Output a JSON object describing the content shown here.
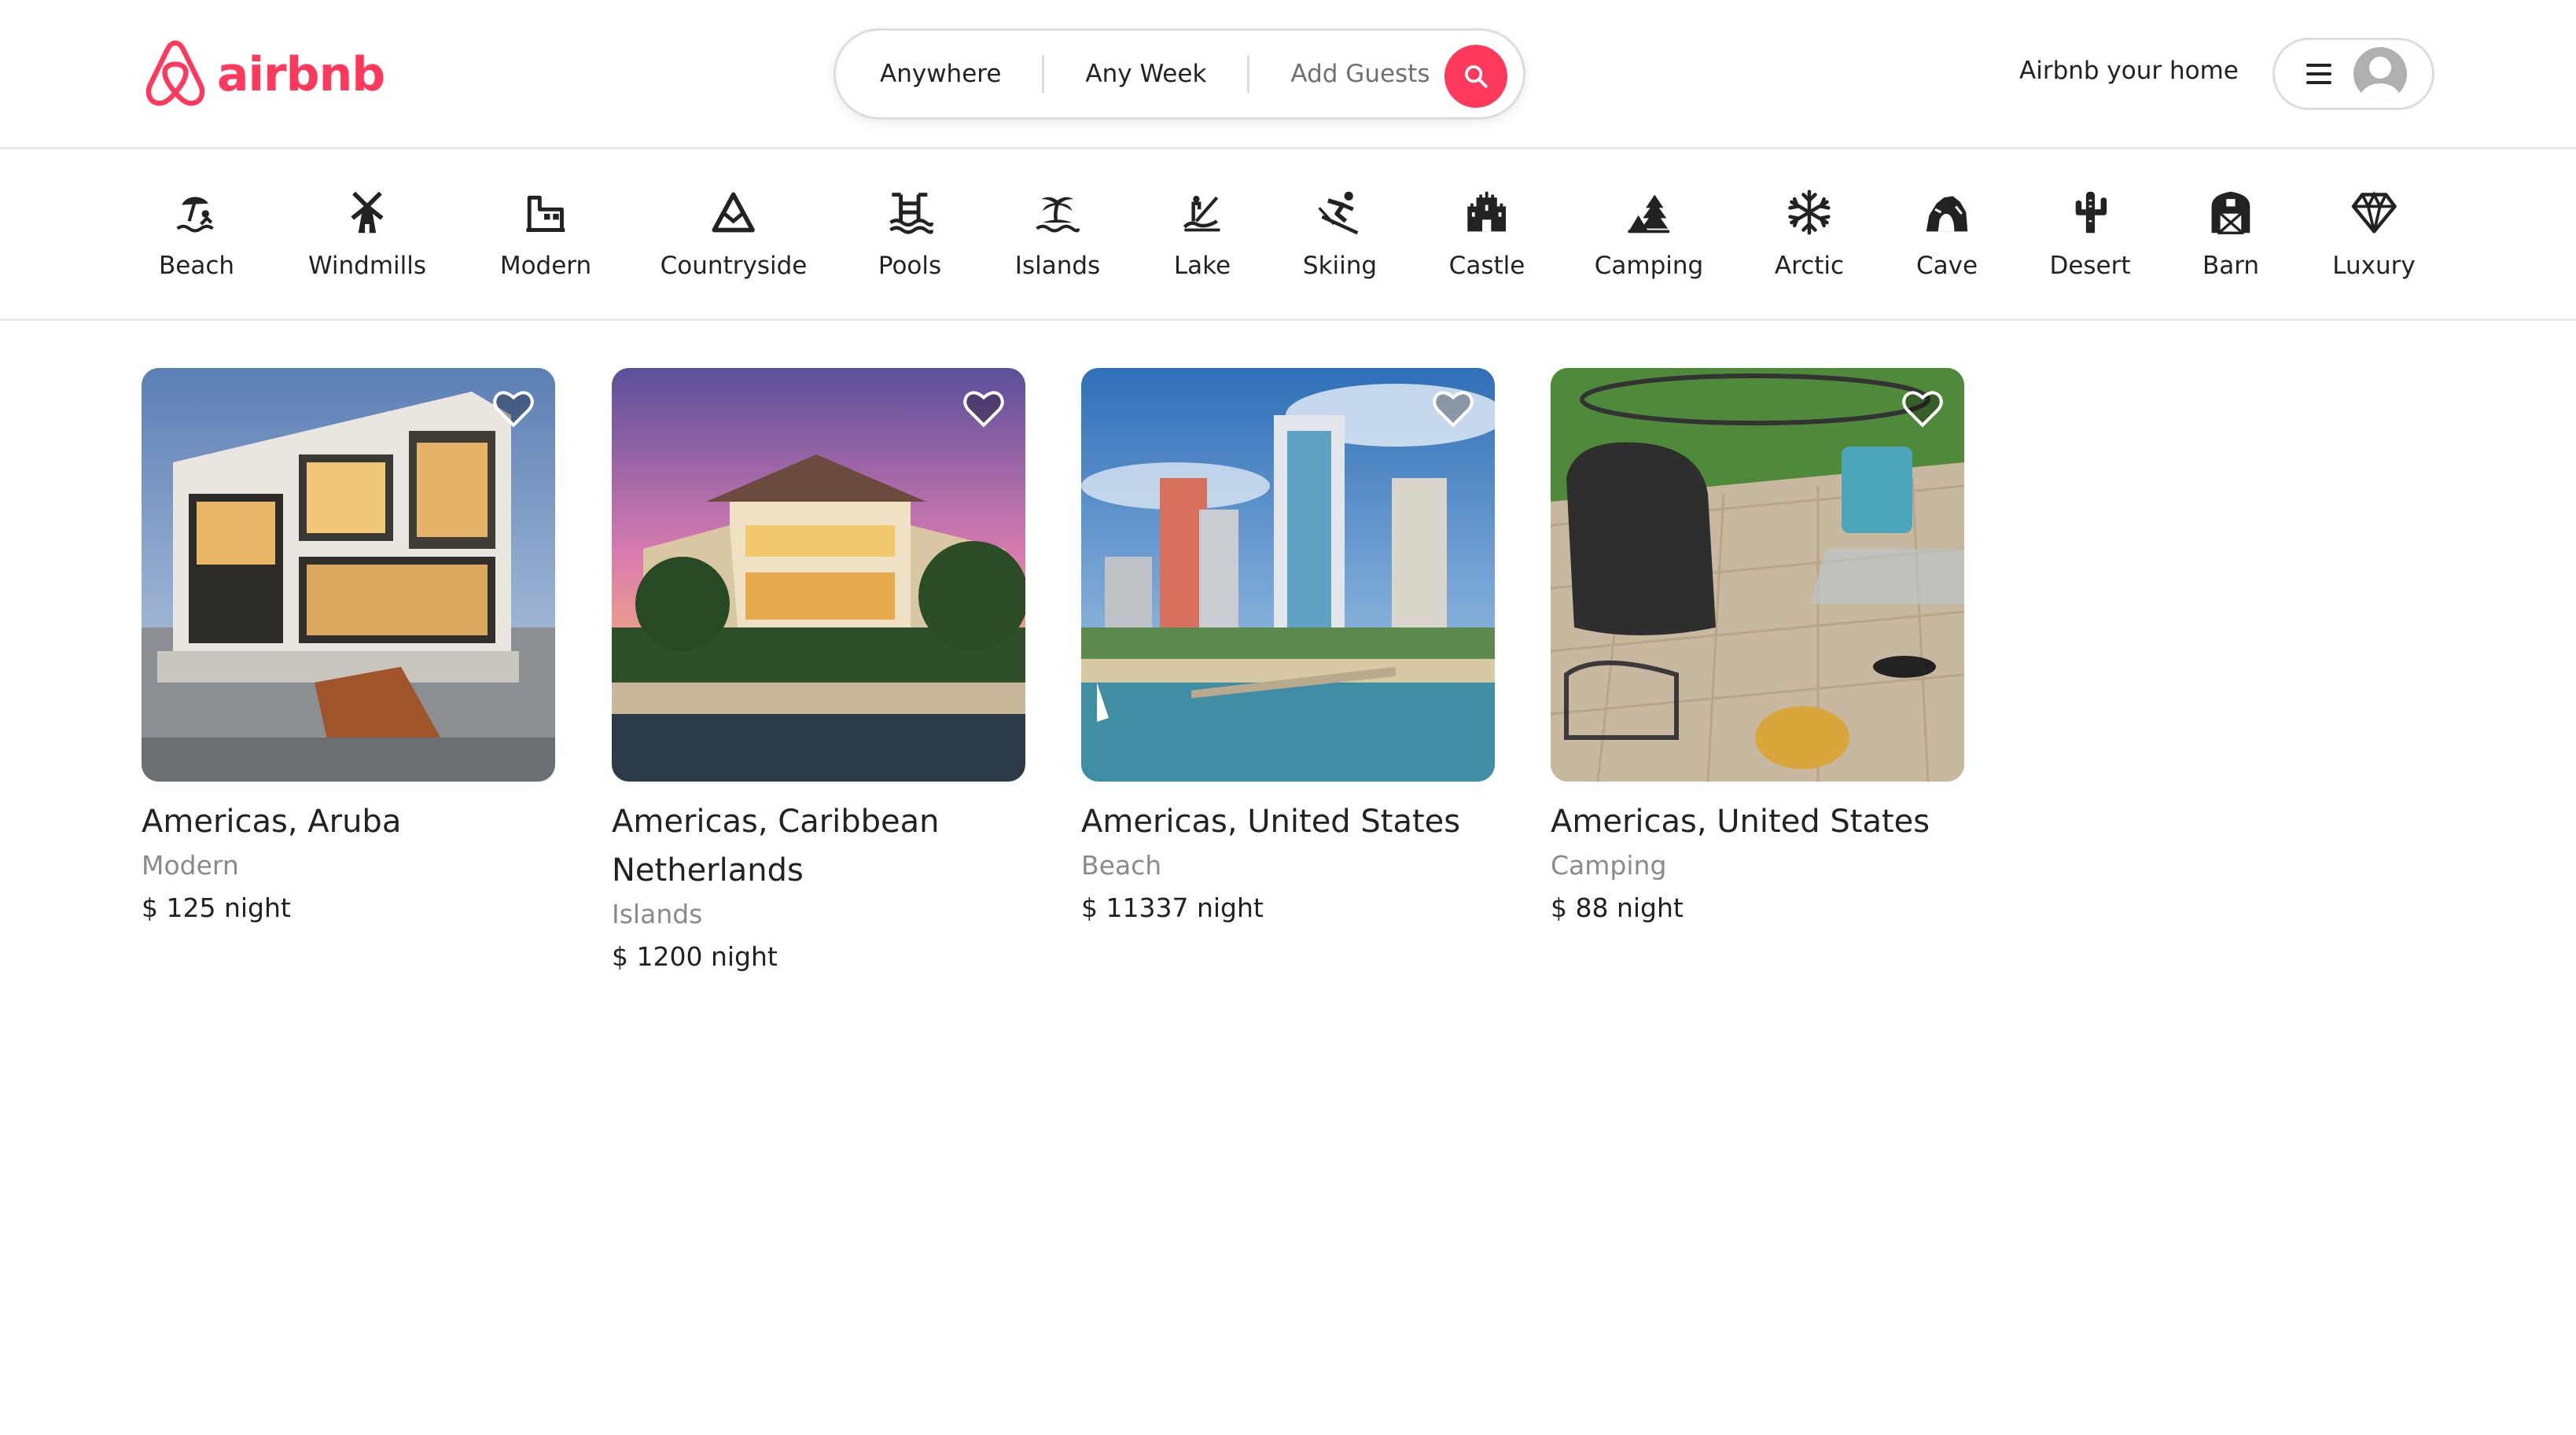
{
  "header": {
    "brand": "airbnb",
    "search": {
      "location": "Anywhere",
      "week": "Any Week",
      "guests": "Add Guests"
    },
    "host_link": "Airbnb your home"
  },
  "icons": {
    "logo": "airbnb-logo-icon",
    "search": "search-icon",
    "menu": "hamburger-menu-icon",
    "avatar": "user-avatar-icon",
    "heart": "heart-icon"
  },
  "categories": [
    {
      "label": "Beach",
      "icon": "beach-icon"
    },
    {
      "label": "Windmills",
      "icon": "windmill-icon"
    },
    {
      "label": "Modern",
      "icon": "modern-house-icon"
    },
    {
      "label": "Countryside",
      "icon": "mountain-icon"
    },
    {
      "label": "Pools",
      "icon": "pool-icon"
    },
    {
      "label": "Islands",
      "icon": "island-icon"
    },
    {
      "label": "Lake",
      "icon": "lake-icon"
    },
    {
      "label": "Skiing",
      "icon": "skiing-icon"
    },
    {
      "label": "Castle",
      "icon": "castle-icon"
    },
    {
      "label": "Camping",
      "icon": "camping-icon"
    },
    {
      "label": "Arctic",
      "icon": "snowflake-icon"
    },
    {
      "label": "Cave",
      "icon": "cave-icon"
    },
    {
      "label": "Desert",
      "icon": "cactus-icon"
    },
    {
      "label": "Barn",
      "icon": "barn-icon"
    },
    {
      "label": "Luxury",
      "icon": "diamond-icon"
    }
  ],
  "listings": [
    {
      "title": "Americas, Aruba",
      "category": "Modern",
      "price": "$ 125 night"
    },
    {
      "title": "Americas, Caribbean Netherlands",
      "category": "Islands",
      "price": "$ 1200 night"
    },
    {
      "title": "Americas, United States",
      "category": "Beach",
      "price": "$ 11337 night"
    },
    {
      "title": "Americas, United States",
      "category": "Camping",
      "price": "$ 88 night"
    }
  ],
  "colors": {
    "brand": "#ff385c",
    "text": "#222222",
    "muted": "#8a8a8a",
    "border": "#dddddd"
  }
}
